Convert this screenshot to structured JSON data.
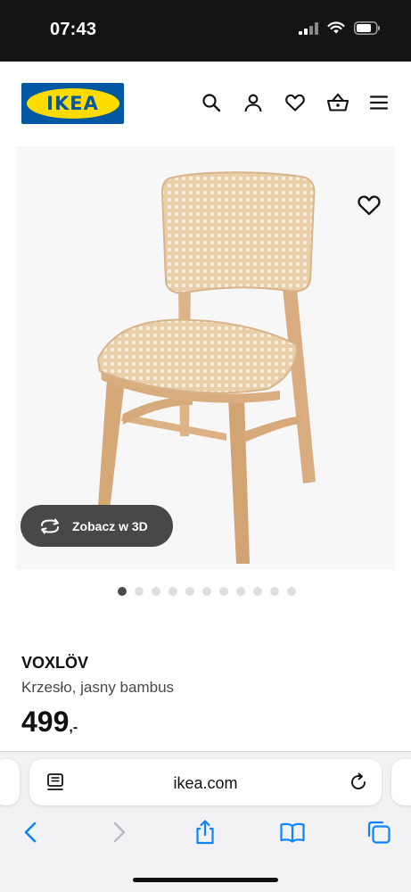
{
  "status_bar": {
    "time": "07:43"
  },
  "header": {
    "logo_text": "IKEA",
    "brand_blue": "#0058a3",
    "brand_yellow": "#ffdb00",
    "icons": [
      "search-icon",
      "user-icon",
      "heart-icon",
      "basket-icon",
      "menu-icon"
    ]
  },
  "gallery": {
    "view_3d_label": "Zobacz w 3D",
    "dot_count": 11,
    "active_index": 0
  },
  "product": {
    "name": "VOXLÖV",
    "description": "Krzesło, jasny bambus",
    "price": "499",
    "price_suffix": ",-"
  },
  "browser": {
    "url": "ikea.com",
    "accent": "#0a84ff"
  }
}
